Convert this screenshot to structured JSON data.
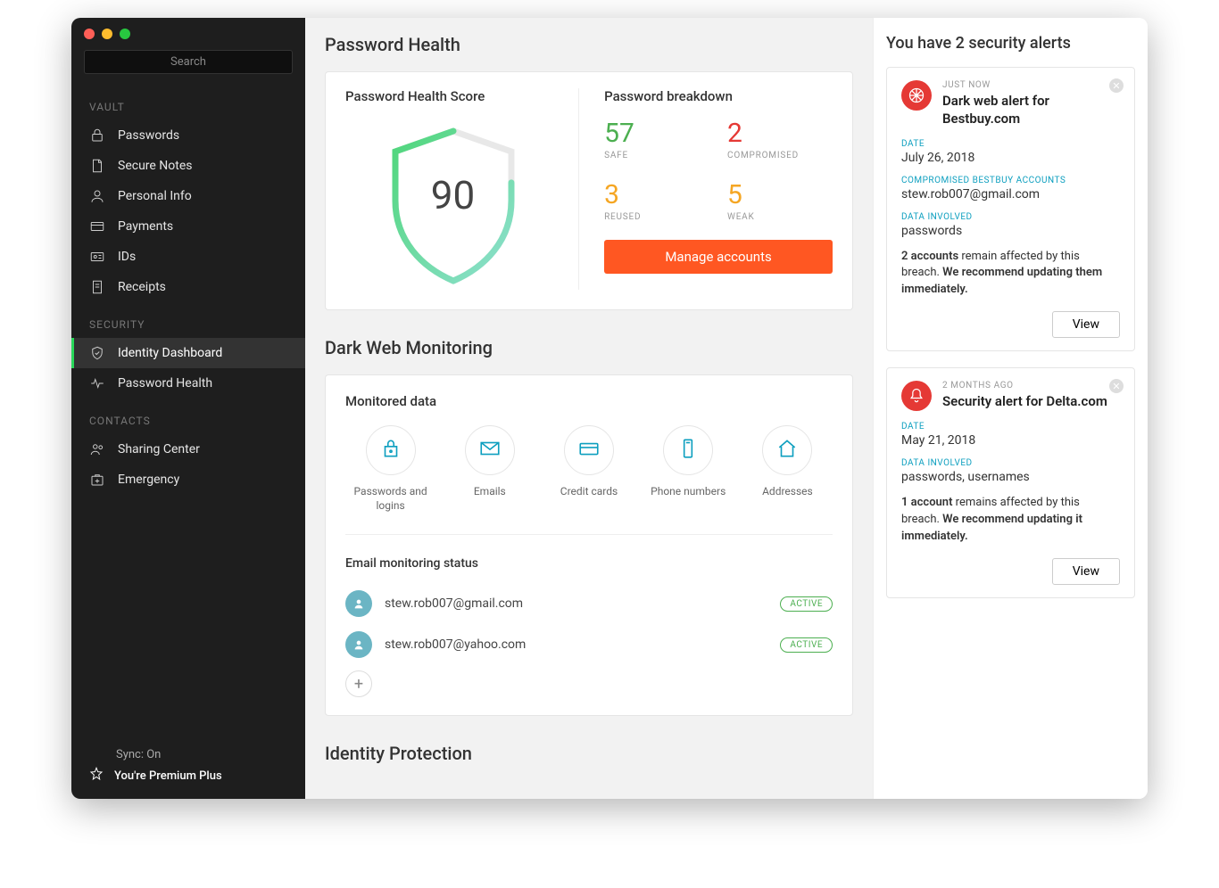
{
  "sidebar": {
    "search_placeholder": "Search",
    "sections": {
      "vault": {
        "header": "VAULT",
        "items": [
          "Passwords",
          "Secure Notes",
          "Personal Info",
          "Payments",
          "IDs",
          "Receipts"
        ]
      },
      "security": {
        "header": "SECURITY",
        "items": [
          "Identity Dashboard",
          "Password Health"
        ]
      },
      "contacts": {
        "header": "CONTACTS",
        "items": [
          "Sharing Center",
          "Emergency"
        ]
      }
    },
    "sync": "Sync: On",
    "premium": "You're Premium Plus"
  },
  "main": {
    "ph_heading": "Password Health",
    "ph_score_title": "Password Health Score",
    "ph_score": "90",
    "breakdown_title": "Password breakdown",
    "breakdown": {
      "safe": {
        "num": "57",
        "label": "SAFE"
      },
      "compromised": {
        "num": "2",
        "label": "COMPROMISED"
      },
      "reused": {
        "num": "3",
        "label": "REUSED"
      },
      "weak": {
        "num": "5",
        "label": "WEAK"
      }
    },
    "manage_btn": "Manage accounts",
    "dwm_heading": "Dark Web Monitoring",
    "monitored_title": "Monitored data",
    "monitored": [
      "Passwords and logins",
      "Emails",
      "Credit cards",
      "Phone numbers",
      "Addresses"
    ],
    "email_status_title": "Email monitoring status",
    "emails": [
      {
        "addr": "stew.rob007@gmail.com",
        "status": "ACTIVE"
      },
      {
        "addr": "stew.rob007@yahoo.com",
        "status": "ACTIVE"
      }
    ],
    "identity_heading": "Identity Protection"
  },
  "alerts": {
    "title": "You have 2 security alerts",
    "items": [
      {
        "time": "JUST NOW",
        "title": "Dark web alert for Bestbuy.com",
        "date_label": "DATE",
        "date": "July 26, 2018",
        "extra_label": "COMPROMISED BESTBUY ACCOUNTS",
        "extra_value": "stew.rob007@gmail.com",
        "data_label": "DATA INVOLVED",
        "data_value": "passwords",
        "msg_bold1": "2 accounts",
        "msg_mid": " remain affected by this breach. ",
        "msg_bold2": "We recommend updating them immediately.",
        "view": "View",
        "icon": "dark-web"
      },
      {
        "time": "2 MONTHS AGO",
        "title": "Security alert for Delta.com",
        "date_label": "DATE",
        "date": "May 21, 2018",
        "extra_label": "",
        "extra_value": "",
        "data_label": "DATA INVOLVED",
        "data_value": "passwords, usernames",
        "msg_bold1": "1 account",
        "msg_mid": " remains affected by this breach. ",
        "msg_bold2": "We recommend updating it immediately.",
        "view": "View",
        "icon": "bell"
      }
    ]
  }
}
